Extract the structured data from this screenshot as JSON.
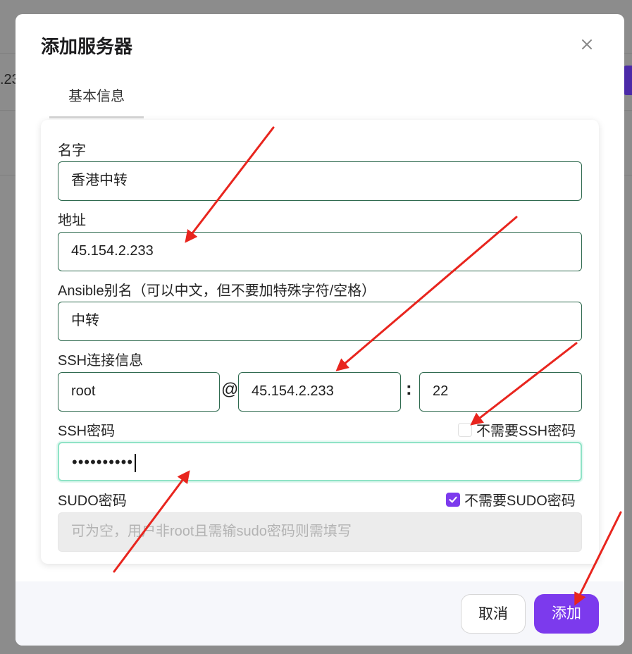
{
  "background": {
    "partial_text": ".23"
  },
  "dialog": {
    "title": "添加服务器",
    "tab_label": "基本信息"
  },
  "form": {
    "name": {
      "label": "名字",
      "value": "香港中转"
    },
    "address": {
      "label": "地址",
      "value": "45.154.2.233"
    },
    "alias": {
      "label": "Ansible别名（可以中文，但不要加特殊字符/空格）",
      "value": "中转"
    },
    "ssh": {
      "label": "SSH连接信息",
      "user": "root",
      "at": "@",
      "host": "45.154.2.233",
      "colon": ":",
      "port": "22"
    },
    "ssh_password": {
      "label": "SSH密码",
      "value": "••••••••••",
      "no_password_label": "不需要SSH密码",
      "no_password_checked": false
    },
    "sudo_password": {
      "label": "SUDO密码",
      "placeholder": "可为空，用户非root且需输sudo密码则需填写",
      "no_password_label": "不需要SUDO密码",
      "no_password_checked": true
    }
  },
  "footer": {
    "cancel_label": "取消",
    "add_label": "添加"
  },
  "colors": {
    "accent": "#7c3aed",
    "field_border": "#2f6a4f",
    "focus_border": "#8fe3c6",
    "annotation_arrow": "#e8251e"
  }
}
